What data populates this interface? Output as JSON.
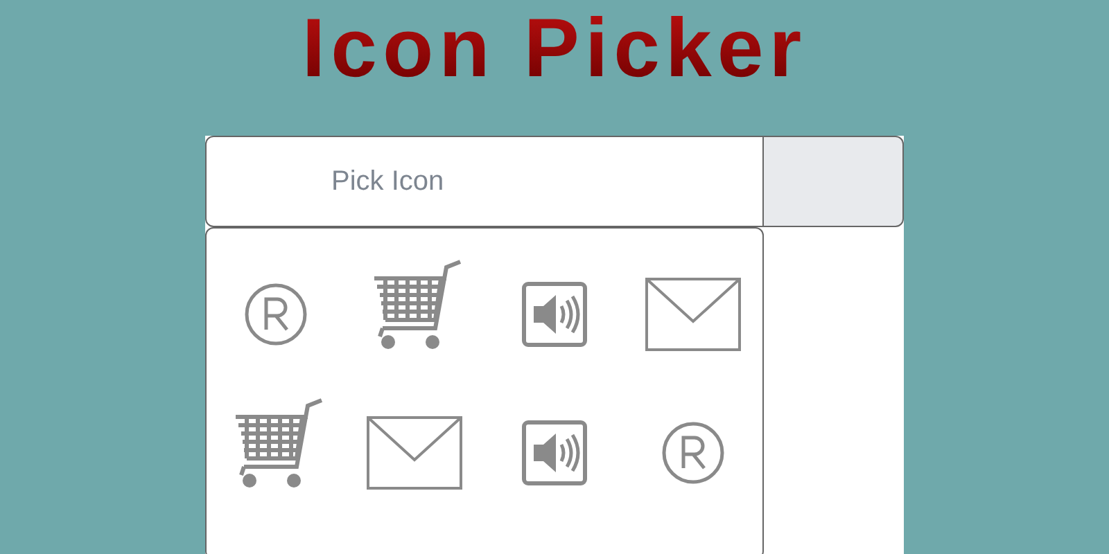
{
  "title": "Icon Picker",
  "picker": {
    "placeholder": "Pick Icon",
    "icons": [
      {
        "kind": "registered"
      },
      {
        "kind": "cart"
      },
      {
        "kind": "speaker"
      },
      {
        "kind": "envelope"
      },
      {
        "kind": "cart"
      },
      {
        "kind": "envelope"
      },
      {
        "kind": "speaker"
      },
      {
        "kind": "registered"
      }
    ]
  }
}
